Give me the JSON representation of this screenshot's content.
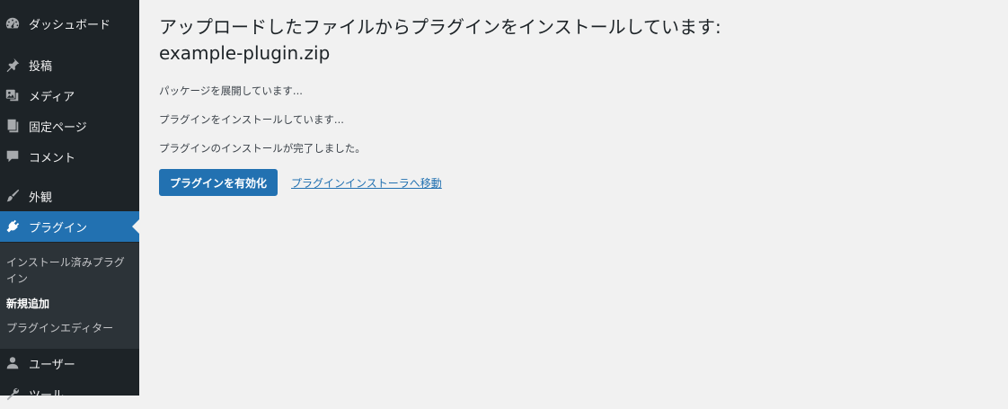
{
  "sidebar": {
    "items": [
      {
        "label": "ダッシュボード",
        "icon": "dashboard-icon"
      },
      {
        "label": "投稿",
        "icon": "pin-icon"
      },
      {
        "label": "メディア",
        "icon": "media-icon"
      },
      {
        "label": "固定ページ",
        "icon": "page-icon"
      },
      {
        "label": "コメント",
        "icon": "comment-icon"
      },
      {
        "label": "外観",
        "icon": "brush-icon"
      },
      {
        "label": "プラグイン",
        "icon": "plugin-icon"
      },
      {
        "label": "ユーザー",
        "icon": "user-icon"
      },
      {
        "label": "ツール",
        "icon": "wrench-icon"
      }
    ],
    "submenu": [
      {
        "label": "インストール済みプラグイン"
      },
      {
        "label": "新規追加"
      },
      {
        "label": "プラグインエディター"
      }
    ],
    "colors": {
      "background": "#1d2327",
      "current": "#2271b1",
      "submenu": "#2c3338"
    }
  },
  "main": {
    "title": "アップロードしたファイルからプラグインをインストールしています: example-plugin.zip",
    "log": [
      "パッケージを展開しています...",
      "プラグインをインストールしています...",
      "プラグインのインストールが完了しました。"
    ],
    "activate_label": "プラグインを有効化",
    "installer_link_label": "プラグインインストーラへ移動",
    "colors": {
      "accent": "#2271b1",
      "text": "#1d2327"
    }
  }
}
